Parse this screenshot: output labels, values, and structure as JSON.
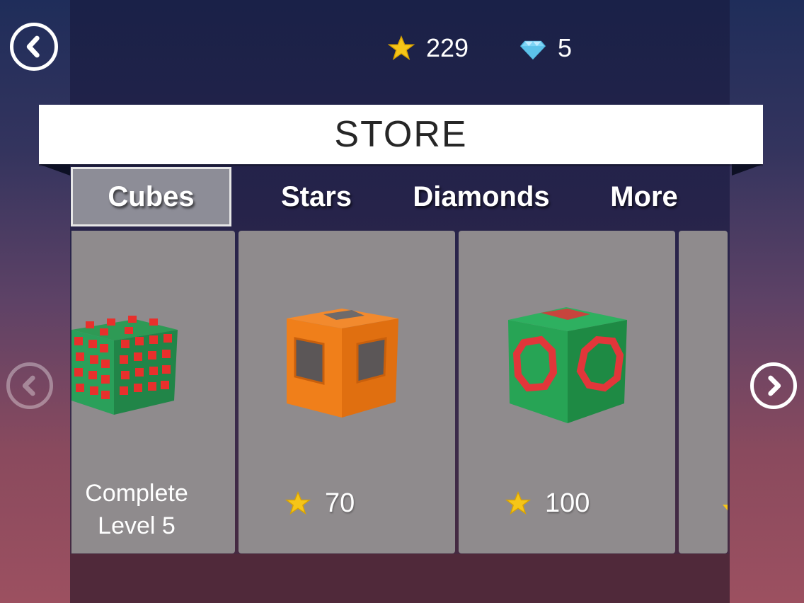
{
  "header": {
    "stars_count": "229",
    "diamonds_count": "5"
  },
  "store": {
    "title": "STORE"
  },
  "tabs": [
    {
      "label": "Cubes",
      "active": true
    },
    {
      "label": "Stars",
      "active": false
    },
    {
      "label": "Diamonds",
      "active": false
    },
    {
      "label": "More",
      "active": false
    }
  ],
  "items": [
    {
      "name": "red-green-spiky-cube",
      "unlock": "Complete\nLevel 5"
    },
    {
      "name": "orange-window-cube",
      "price": "70",
      "currency": "star-icon"
    },
    {
      "name": "green-octagon-cube",
      "price": "100",
      "currency": "star-icon"
    }
  ],
  "colors": {
    "star": "#f5c518",
    "diamond": "#7fd4f5",
    "card": "#8f8b8d",
    "active_tab": "#8d8d97"
  }
}
